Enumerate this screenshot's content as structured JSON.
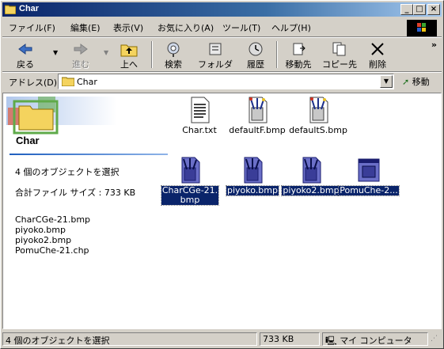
{
  "window": {
    "title": "Char"
  },
  "menu": [
    "ファイル(F)",
    "編集(E)",
    "表示(V)",
    "お気に入り(A)",
    "ツール(T)",
    "ヘルプ(H)"
  ],
  "toolbar": {
    "back": "戻る",
    "forward": "進む",
    "up": "上へ",
    "search": "検索",
    "folders": "フォルダ",
    "history": "履歴",
    "move_to": "移動先",
    "copy_to": "コピー先",
    "delete": "削除",
    "more": "»"
  },
  "address": {
    "label": "アドレス(D)",
    "value": "Char",
    "go": "移動"
  },
  "sidebar": {
    "title": "Char",
    "selection_count": "4 個のオブジェクトを選択",
    "total_size": "合計ファイル サイズ : 733 KB",
    "selected_files": [
      "CharCGe-21.bmp",
      "piyoko.bmp",
      "piyoko2.bmp",
      "PomuChe-21.chp"
    ]
  },
  "files": [
    {
      "name": "Char.txt",
      "type": "text",
      "selected": false
    },
    {
      "name": "defaultF.bmp",
      "type": "bmp",
      "selected": false
    },
    {
      "name": "defaultS.bmp",
      "type": "bmp",
      "selected": false
    },
    {
      "name": "CharCGe-21.bmp",
      "type": "bmp",
      "selected": true
    },
    {
      "name": "piyoko.bmp",
      "type": "bmp",
      "selected": true
    },
    {
      "name": "piyoko2.bmp",
      "type": "bmp",
      "selected": true
    },
    {
      "name": "PomuChe-2...",
      "type": "chp",
      "selected": true
    }
  ],
  "file_label_lines": {
    "charcge_line1": "CharCGe-21.",
    "charcge_line2": "bmp"
  },
  "status": {
    "message": "4 個のオブジェクトを選択",
    "size": "733 KB",
    "zone": "マイ コンピュータ"
  },
  "colors": {
    "titlebar": "#0a246a",
    "selection": "#0a246a",
    "chrome": "#d4d0c8"
  }
}
